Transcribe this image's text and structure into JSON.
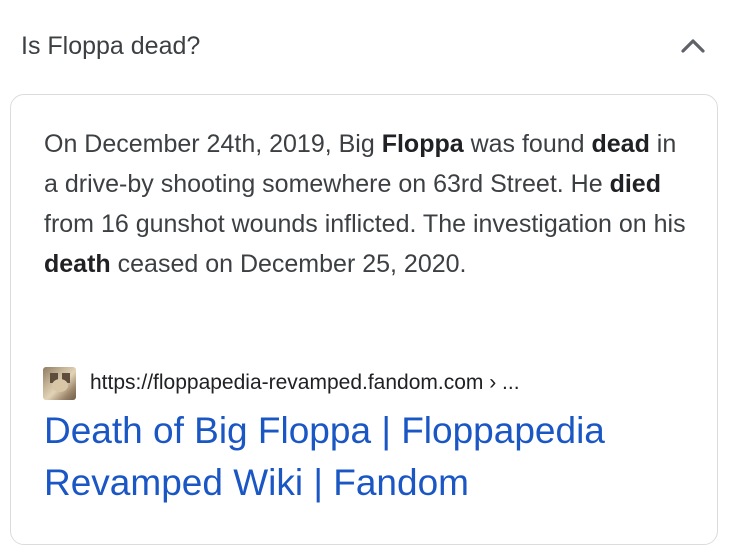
{
  "question": {
    "text": "Is Floppa dead?",
    "toggle_icon": "chevron-up-icon"
  },
  "answer": {
    "snippet_parts": {
      "p1": "On December 24th, 2019, Big ",
      "b1": "Floppa",
      "p2": " was found ",
      "b2": "dead",
      "p3": " in a drive-by shooting somewhere on 63rd Street. He ",
      "b3": "died",
      "p4": " from 16 gunshot wounds inflicted. The investigation on his ",
      "b4": "death",
      "p5": " ceased on December 25, 2020."
    },
    "source": {
      "favicon": "floppa-favicon-icon",
      "url": "https://floppapedia-revamped.fandom.com › ..."
    },
    "result_title": "Death of Big Floppa | Floppapedia Revamped Wiki | Fandom"
  },
  "colors": {
    "link": "#1a57c4",
    "text": "#3c4043",
    "border": "#dadce0"
  }
}
